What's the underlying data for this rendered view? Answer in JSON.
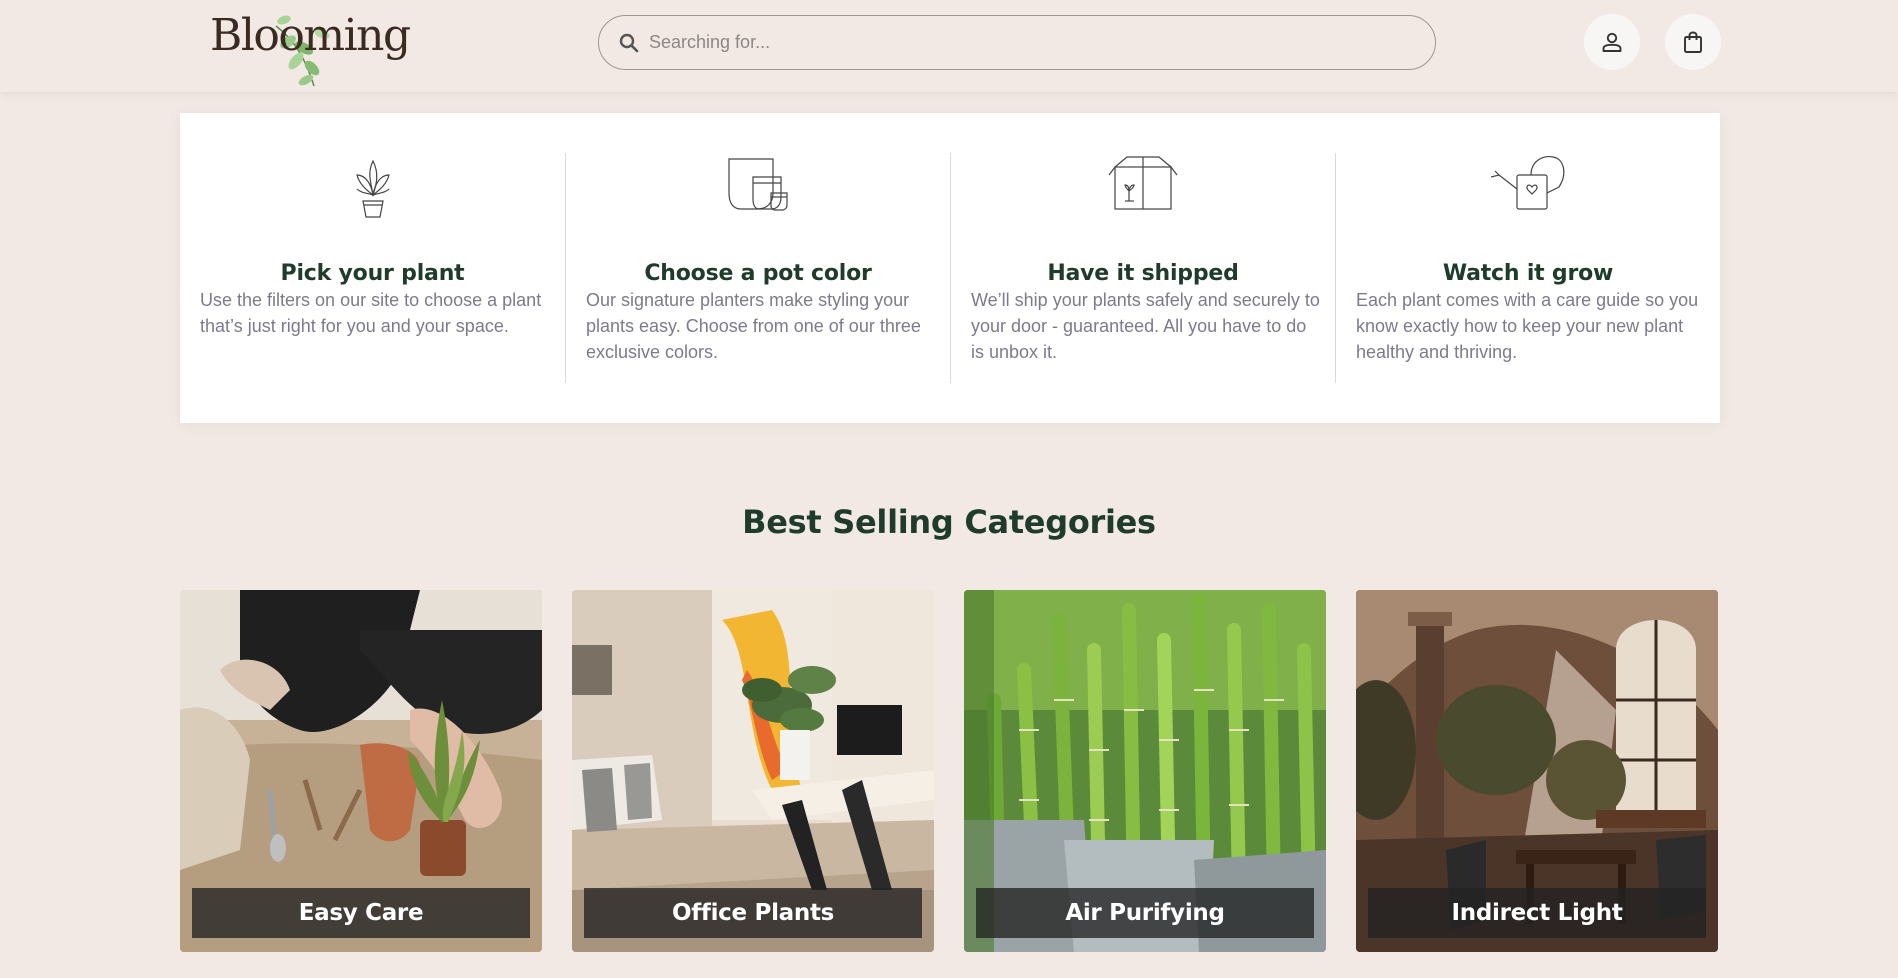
{
  "header": {
    "logo_text": "Blooming",
    "search_placeholder": "Searching for...",
    "icons": [
      "user-icon",
      "shopping-bag-icon",
      "search-icon"
    ]
  },
  "steps": [
    {
      "icon": "potted-plant-icon",
      "title": "Pick your plant",
      "description": "Use the filters on our site to choose a plant that’s just right for you and your space."
    },
    {
      "icon": "pots-icon",
      "title": "Choose a pot color",
      "description": "Our signature planters make styling your plants easy. Choose from one of our three exclusive colors."
    },
    {
      "icon": "shipping-box-icon",
      "title": "Have it shipped",
      "description": "We’ll ship your plants safely and securely to your door - guaranteed. All you have to do is unbox it."
    },
    {
      "icon": "watering-can-icon",
      "title": "Watch it grow",
      "description": "Each plant comes with a care guide so you know exactly how to keep your new plant healthy and thriving."
    }
  ],
  "categories": {
    "title": "Best Selling Categories",
    "items": [
      {
        "label": "Easy Care"
      },
      {
        "label": "Office Plants"
      },
      {
        "label": "Air Purifying"
      },
      {
        "label": "Indirect Light"
      }
    ]
  },
  "colors": {
    "background": "#f2e9e4",
    "brand_green": "#1f3b2c",
    "muted_text": "#7e7a8c",
    "card": "#ffffff"
  }
}
